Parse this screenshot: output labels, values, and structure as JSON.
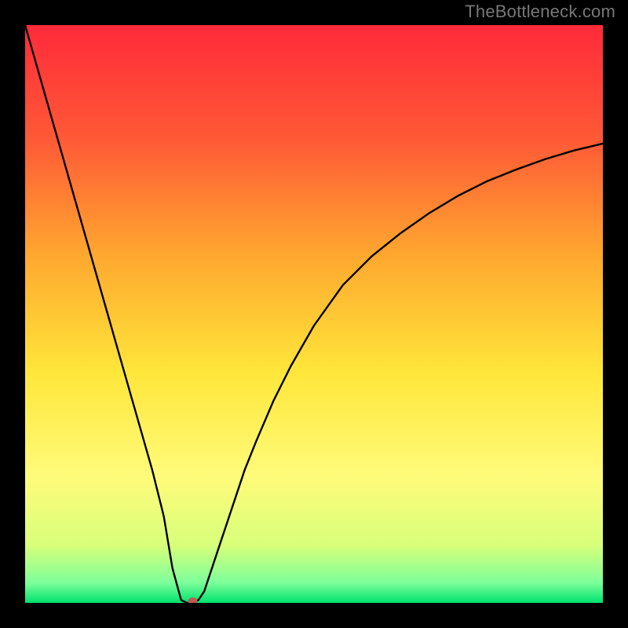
{
  "watermark": "TheBottleneck.com",
  "chart_data": {
    "type": "line",
    "title": "",
    "xlabel": "",
    "ylabel": "",
    "xlim": [
      0,
      100
    ],
    "ylim": [
      0,
      100
    ],
    "background_gradient": {
      "stops": [
        {
          "offset": 0.0,
          "color": "#ff2a3a"
        },
        {
          "offset": 0.2,
          "color": "#ff5a36"
        },
        {
          "offset": 0.4,
          "color": "#ffa82f"
        },
        {
          "offset": 0.6,
          "color": "#ffe63a"
        },
        {
          "offset": 0.78,
          "color": "#fffb7a"
        },
        {
          "offset": 0.9,
          "color": "#d8ff7a"
        },
        {
          "offset": 0.965,
          "color": "#7dff9a"
        },
        {
          "offset": 1.0,
          "color": "#00e26e"
        }
      ]
    },
    "series": [
      {
        "name": "bottleneck-curve",
        "x": [
          0,
          2,
          4,
          6,
          8,
          10,
          12,
          14,
          16,
          18,
          20,
          22,
          24,
          25.5,
          27,
          28,
          29,
          30,
          31,
          32,
          34,
          36,
          38,
          40,
          43,
          46,
          50,
          55,
          60,
          65,
          70,
          75,
          80,
          85,
          90,
          95,
          100
        ],
        "y": [
          100,
          93,
          86,
          79,
          72,
          65,
          58,
          51,
          44,
          37,
          30,
          23,
          15,
          6,
          0.5,
          0,
          0,
          0.5,
          2,
          5,
          11,
          17,
          23,
          28,
          35,
          41,
          48,
          55,
          60,
          64,
          67.5,
          70.5,
          73,
          75,
          76.8,
          78.3,
          79.5
        ]
      }
    ],
    "marker": {
      "x": 29,
      "y": 0,
      "color": "#c05a50",
      "rx": 6,
      "ry": 5
    }
  }
}
